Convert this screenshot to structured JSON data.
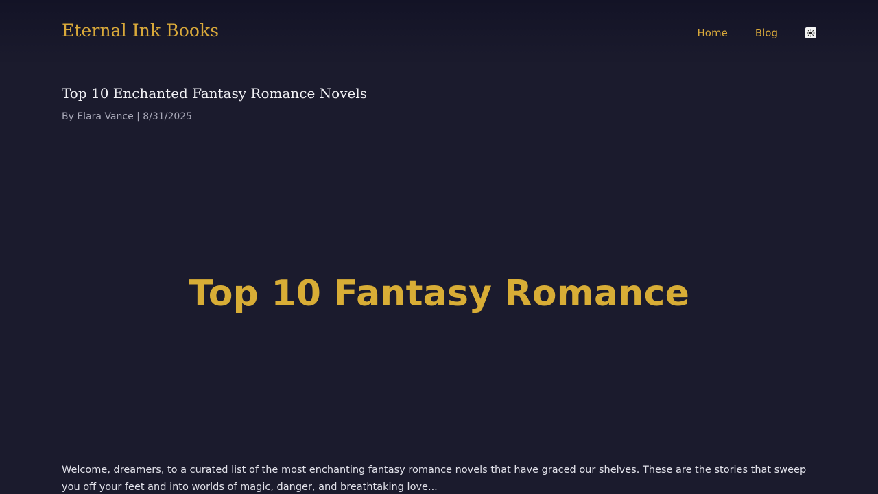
{
  "header": {
    "site_title": "Eternal Ink Books",
    "nav": [
      {
        "label": "Home"
      },
      {
        "label": "Blog"
      }
    ],
    "theme_toggle": {
      "icon": "sun-icon",
      "glyph": "☀"
    }
  },
  "post": {
    "title": "Top 10 Enchanted Fantasy Romance Novels",
    "byline": "By Elara Vance | 8/31/2025",
    "hero_text": "Top 10 Fantasy Romance",
    "intro": "Welcome, dreamers, to a curated list of the most enchanting fantasy romance novels that have graced our shelves. These are the stories that sweep you off your feet and into worlds of magic, danger, and breathtaking love..."
  },
  "colors": {
    "background": "#1b1b2d",
    "accent": "#d9a93a",
    "text": "#e6e6ee",
    "muted": "#a9a9b8"
  }
}
